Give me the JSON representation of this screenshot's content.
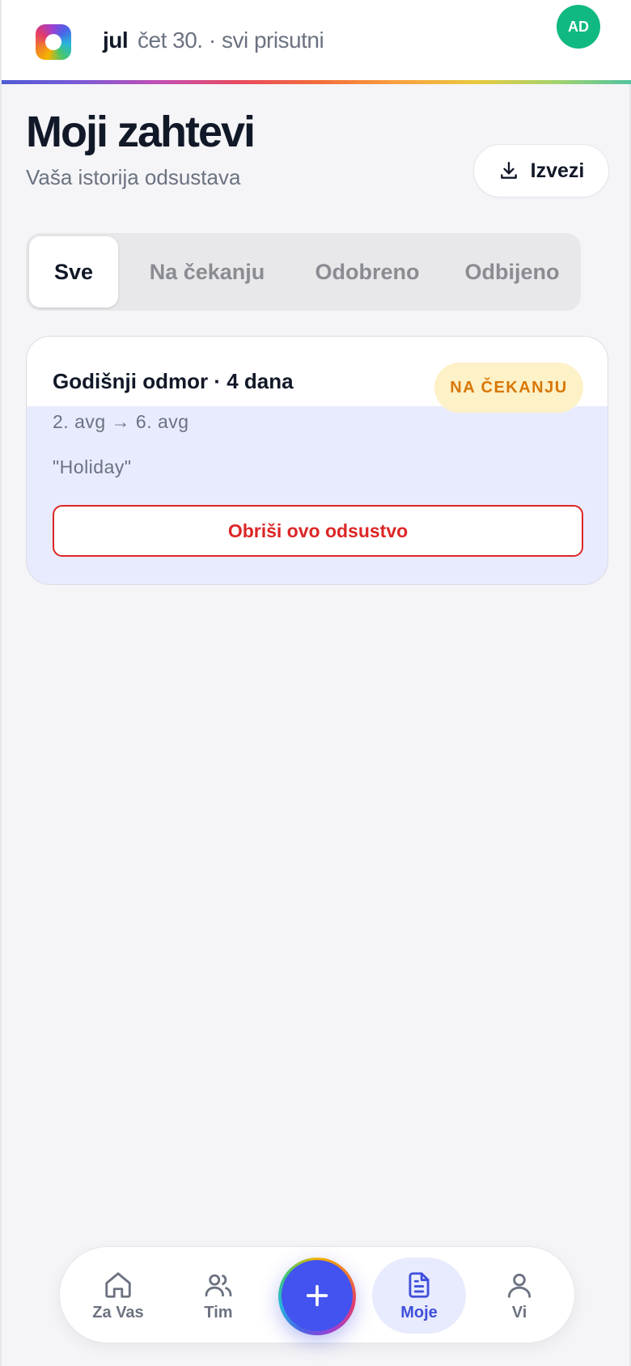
{
  "header": {
    "month": "jul",
    "subtitle": "čet 30. · svi prisutni",
    "avatar_initials": "AD"
  },
  "page": {
    "title": "Moji zahtevi",
    "subtitle": "Vaša istorija odsustava",
    "export_label": "Izvezi"
  },
  "tabs": [
    {
      "label": "Sve",
      "active": true
    },
    {
      "label": "Na čekanju",
      "active": false
    },
    {
      "label": "Odobreno",
      "active": false
    },
    {
      "label": "Odbijeno",
      "active": false
    }
  ],
  "requests": [
    {
      "title": "Godišnji odmor · 4 dana",
      "status": "NA ČEKANJU",
      "dates": "2. avg → 6. avg",
      "note": "\"Holiday\"",
      "delete_label": "Obriši ovo odsustvo"
    }
  ],
  "nav": {
    "items": [
      {
        "label": "Za Vas",
        "icon": "home-icon"
      },
      {
        "label": "Tim",
        "icon": "users-icon"
      },
      {
        "label": "Moje",
        "icon": "document-icon",
        "active": true
      },
      {
        "label": "Vi",
        "icon": "user-icon"
      }
    ],
    "fab_icon": "plus-icon"
  },
  "colors": {
    "accent": "#4353ef",
    "avatar": "#10b981",
    "pending_bg": "#fdf1c7",
    "pending_text": "#d97706",
    "danger": "#dc2626",
    "card_bg": "#e8ebfd"
  }
}
